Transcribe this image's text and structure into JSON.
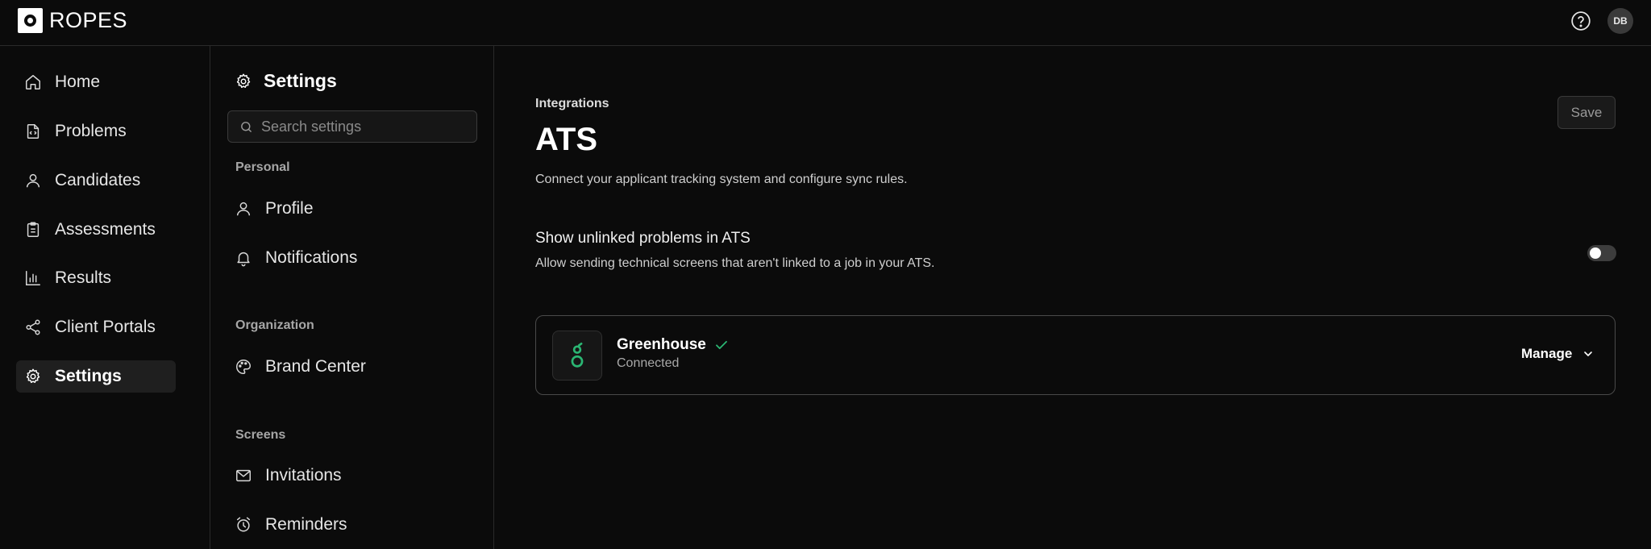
{
  "app": {
    "name": "ROPES",
    "user_initials": "DB"
  },
  "nav": {
    "items": [
      {
        "label": "Home",
        "icon": "home-icon"
      },
      {
        "label": "Problems",
        "icon": "code-file-icon"
      },
      {
        "label": "Candidates",
        "icon": "user-icon"
      },
      {
        "label": "Assessments",
        "icon": "clipboard-icon"
      },
      {
        "label": "Results",
        "icon": "bar-chart-icon"
      },
      {
        "label": "Client Portals",
        "icon": "share-icon"
      },
      {
        "label": "Settings",
        "icon": "gear-icon",
        "active": true
      }
    ]
  },
  "settings_panel": {
    "title": "Settings",
    "search_placeholder": "Search settings",
    "sections": {
      "personal": "Personal",
      "organization": "Organization",
      "screens": "Screens"
    },
    "items": {
      "profile": "Profile",
      "notifications": "Notifications",
      "brand_center": "Brand Center",
      "invitations": "Invitations",
      "reminders": "Reminders"
    }
  },
  "main": {
    "breadcrumb": "Integrations",
    "title": "ATS",
    "description": "Connect your applicant tracking system and configure sync rules.",
    "save_label": "Save",
    "option": {
      "title": "Show unlinked problems in ATS",
      "description": "Allow sending technical screens that aren't linked to a job in your ATS.",
      "enabled": false
    },
    "integration": {
      "name": "Greenhouse",
      "status": "Connected",
      "manage_label": "Manage"
    }
  },
  "colors": {
    "background": "#0b0b0b",
    "accent_green": "#2bb673",
    "border": "#2a2a2a"
  }
}
